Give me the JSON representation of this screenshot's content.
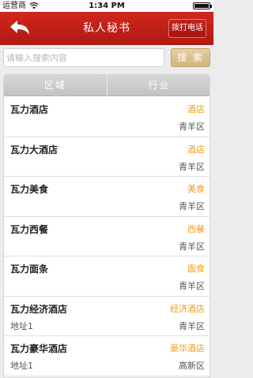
{
  "status_bar": {
    "carrier": "运营商",
    "time": "1:34 PM"
  },
  "nav": {
    "title": "私人秘书",
    "call_button": "拨打电话"
  },
  "search": {
    "placeholder": "请输入搜索内容",
    "value": "",
    "button_label": "搜 索"
  },
  "tabs": [
    {
      "label": "区域"
    },
    {
      "label": "行业"
    }
  ],
  "colors": {
    "nav_red": "#c0241b",
    "category_orange": "#f39c12",
    "search_button_tan": "#d9bd8a"
  },
  "items": [
    {
      "name": "瓦力酒店",
      "category": "酒店",
      "address": "",
      "district": "青羊区"
    },
    {
      "name": "瓦力大酒店",
      "category": "酒店",
      "address": "",
      "district": "青羊区"
    },
    {
      "name": "瓦力美食",
      "category": "美食",
      "address": "",
      "district": "青羊区"
    },
    {
      "name": "瓦力西餐",
      "category": "西餐",
      "address": "",
      "district": "青羊区"
    },
    {
      "name": "瓦力面条",
      "category": "面食",
      "address": "",
      "district": "青羊区"
    },
    {
      "name": "瓦力经济酒店",
      "category": "经济酒店",
      "address": "地址1",
      "district": "青羊区"
    },
    {
      "name": "瓦力豪华酒店",
      "category": "豪华酒店",
      "address": "地址1",
      "district": "高新区"
    }
  ]
}
